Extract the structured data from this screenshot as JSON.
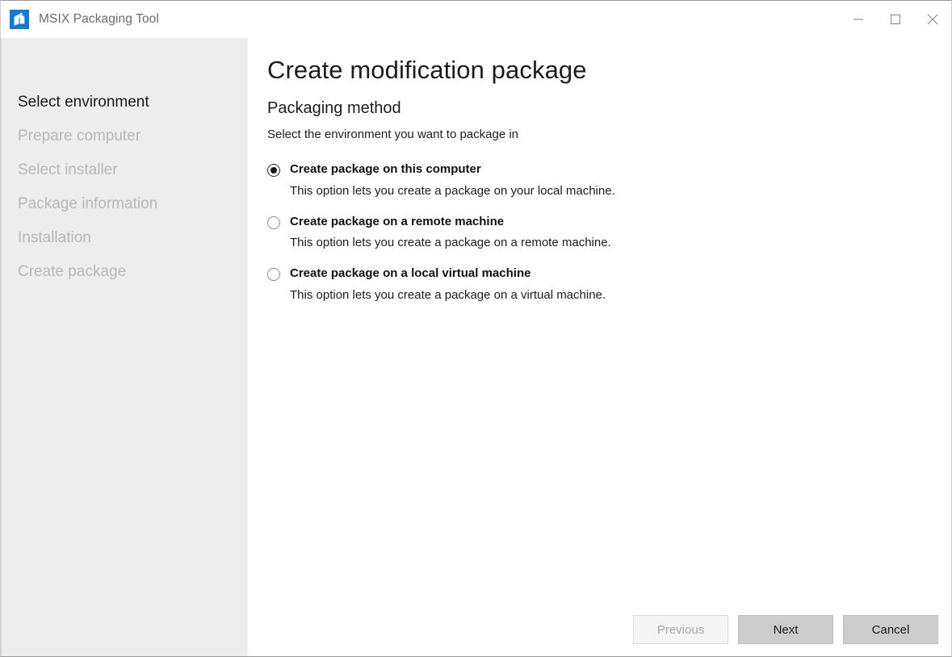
{
  "window": {
    "app_title": "MSIX Packaging Tool",
    "app_icon": "package-box-icon",
    "accent_color": "#0f7ad4",
    "controls": {
      "minimize": "minimize-icon",
      "maximize": "maximize-icon",
      "close": "close-icon"
    }
  },
  "sidebar": {
    "items": [
      {
        "label": "Select environment",
        "state": "active"
      },
      {
        "label": "Prepare computer",
        "state": "disabled"
      },
      {
        "label": "Select installer",
        "state": "disabled"
      },
      {
        "label": "Package information",
        "state": "disabled"
      },
      {
        "label": "Installation",
        "state": "disabled"
      },
      {
        "label": "Create package",
        "state": "disabled"
      }
    ]
  },
  "main": {
    "page_title": "Create modification package",
    "section_title": "Packaging method",
    "section_subtitle": "Select the environment you want to package in",
    "options": [
      {
        "label": "Create package on this computer",
        "description": "This option lets you create a package on your local machine.",
        "selected": true
      },
      {
        "label": "Create package on a remote machine",
        "description": "This option lets you create a package on a remote machine.",
        "selected": false
      },
      {
        "label": "Create package on a local virtual machine",
        "description": "This option lets you create a package on a virtual machine.",
        "selected": false
      }
    ]
  },
  "footer": {
    "previous_label": "Previous",
    "next_label": "Next",
    "cancel_label": "Cancel",
    "previous_disabled": true
  }
}
